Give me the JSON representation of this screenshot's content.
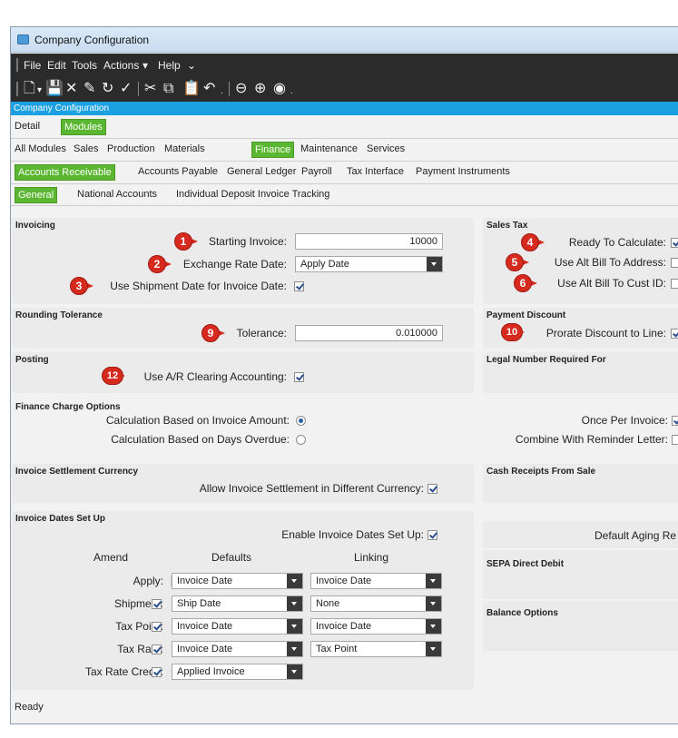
{
  "window": {
    "title": "Company Configuration",
    "status": "Ready"
  },
  "menu": [
    "File",
    "Edit",
    "Tools",
    "Actions",
    "Help"
  ],
  "breadcrumb": "Company Configuration",
  "tabs": {
    "level1": [
      {
        "label": "Detail",
        "active": false
      },
      {
        "label": "Modules",
        "active": true
      }
    ],
    "level2": [
      {
        "label": "All Modules",
        "active": false
      },
      {
        "label": "Sales",
        "active": false
      },
      {
        "label": "Production",
        "active": false
      },
      {
        "label": "Materials",
        "active": false
      },
      {
        "label": "Finance",
        "active": true
      },
      {
        "label": "Maintenance",
        "active": false
      },
      {
        "label": "Services",
        "active": false
      }
    ],
    "level3": [
      {
        "label": "Accounts Receivable",
        "active": true
      },
      {
        "label": "Accounts Payable",
        "active": false
      },
      {
        "label": "General Ledger",
        "active": false
      },
      {
        "label": "Payroll",
        "active": false
      },
      {
        "label": "Tax Interface",
        "active": false
      },
      {
        "label": "Payment Instruments",
        "active": false
      }
    ],
    "level4": [
      {
        "label": "General",
        "active": true
      },
      {
        "label": "National Accounts",
        "active": false
      },
      {
        "label": "Individual Deposit Invoice Tracking",
        "active": false
      }
    ]
  },
  "invoicing": {
    "title": "Invoicing",
    "starting_invoice_label": "Starting Invoice:",
    "starting_invoice_value": "10000",
    "exchange_rate_date_label": "Exchange Rate Date:",
    "exchange_rate_date_value": "Apply Date",
    "use_shipment_date_label": "Use Shipment Date for Invoice Date:",
    "use_shipment_date_checked": true
  },
  "sales_tax": {
    "title": "Sales Tax",
    "ready_to_calculate_label": "Ready To Calculate:",
    "ready_to_calculate_checked": true,
    "use_alt_bill_address_label": "Use Alt Bill To Address:",
    "use_alt_bill_address_checked": false,
    "use_alt_bill_cust_label": "Use Alt Bill To Cust ID:",
    "use_alt_bill_cust_checked": false
  },
  "rounding": {
    "title": "Rounding Tolerance",
    "tolerance_label": "Tolerance:",
    "tolerance_value": "0.010000"
  },
  "payment_discount": {
    "title": "Payment Discount",
    "prorate_label": "Prorate Discount to Line:",
    "prorate_checked": true
  },
  "posting": {
    "title": "Posting",
    "use_ar_clearing_label": "Use A/R Clearing Accounting:",
    "use_ar_clearing_checked": true
  },
  "legal_number": {
    "title": "Legal Number Required For"
  },
  "finance_charge": {
    "title": "Finance Charge Options",
    "calc_invoice_amount_label": "Calculation Based on Invoice Amount:",
    "calc_invoice_amount_selected": true,
    "calc_days_overdue_label": "Calculation Based on Days Overdue:",
    "calc_days_overdue_selected": false,
    "once_per_invoice_label": "Once Per Invoice:",
    "once_per_invoice_checked": true,
    "combine_reminder_label": "Combine With Reminder Letter:",
    "combine_reminder_checked": false
  },
  "settlement": {
    "title": "Invoice Settlement Currency",
    "allow_label": "Allow Invoice Settlement in Different Currency:",
    "allow_checked": true
  },
  "cash_receipts": {
    "title": "Cash Receipts From Sale"
  },
  "invoice_dates": {
    "title": "Invoice Dates Set Up",
    "enable_label": "Enable Invoice Dates Set Up:",
    "enable_checked": true,
    "col_amend": "Amend",
    "col_defaults": "Defaults",
    "col_linking": "Linking",
    "rows": [
      {
        "label": "Apply:",
        "checked": true,
        "disabled": true,
        "default": "Invoice Date",
        "linking": "Invoice Date"
      },
      {
        "label": "Shipment:",
        "checked": true,
        "disabled": false,
        "default": "Ship Date",
        "linking": "None"
      },
      {
        "label": "Tax Point:",
        "checked": true,
        "disabled": false,
        "default": "Invoice Date",
        "linking": "Invoice Date"
      },
      {
        "label": "Tax Rate:",
        "checked": true,
        "disabled": false,
        "default": "Invoice Date",
        "linking": "Tax Point"
      },
      {
        "label": "Tax Rate Credit:",
        "checked": true,
        "disabled": false,
        "default": "Applied Invoice",
        "linking": null
      }
    ]
  },
  "default_aging": {
    "label": "Default Aging Re"
  },
  "sepa": {
    "title": "SEPA Direct Debit"
  },
  "balance_options": {
    "title": "Balance Options"
  },
  "callouts": [
    "1",
    "2",
    "3",
    "4",
    "5",
    "6",
    "9",
    "10",
    "12"
  ]
}
